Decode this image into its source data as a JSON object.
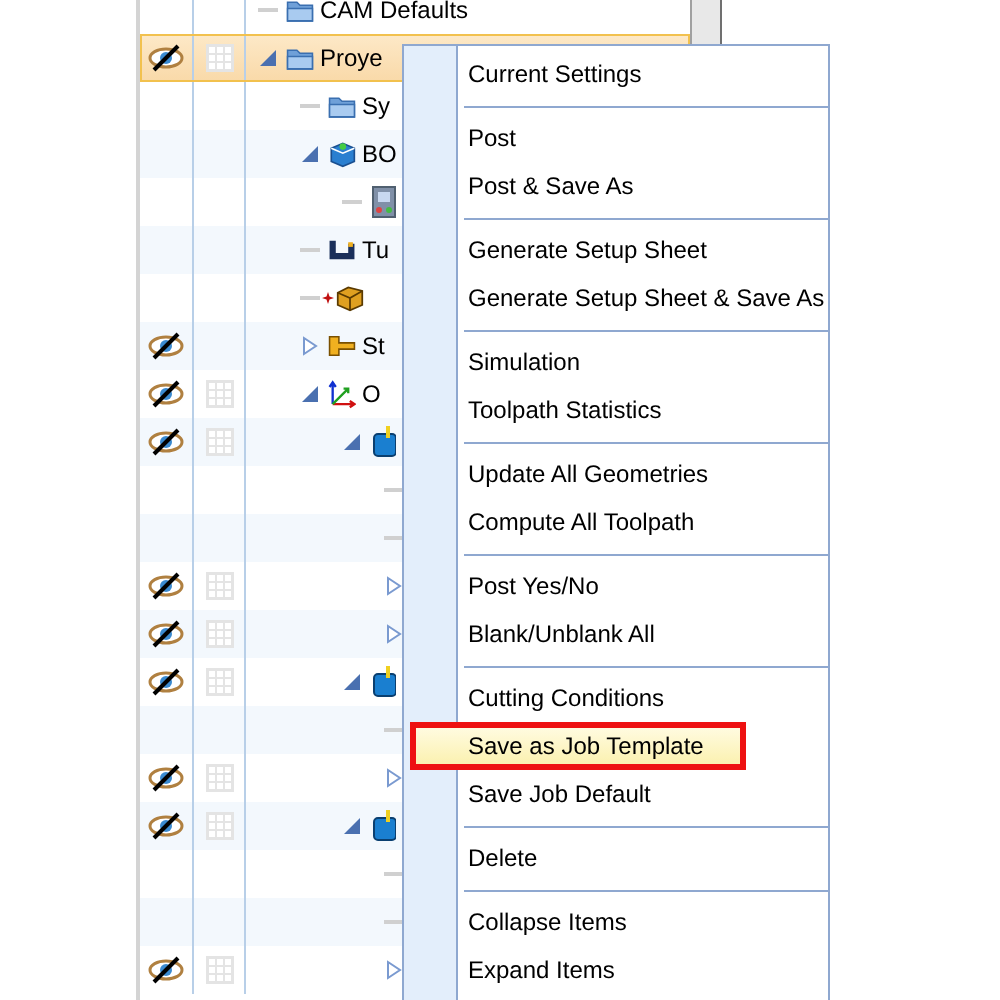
{
  "tree": [
    {
      "label": "CAM Defaults",
      "kind": "folder",
      "eye": false,
      "grid": false,
      "selected": false
    },
    {
      "label": "Proye",
      "kind": "folder",
      "eye": true,
      "grid": true,
      "selected": true,
      "expanded": true,
      "children": [
        {
          "label": "Sy",
          "kind": "folder",
          "eye": false,
          "grid": false,
          "selected": false
        },
        {
          "label": "BO",
          "kind": "machine",
          "eye": false,
          "grid": false,
          "selected": false,
          "expanded": true,
          "children": [
            {
              "kind": "panel",
              "eye": false,
              "grid": false,
              "selected": false
            }
          ]
        },
        {
          "label": "Tu",
          "kind": "tool",
          "eye": false,
          "grid": false,
          "selected": false
        },
        {
          "kind": "stock",
          "eye": false,
          "grid": false,
          "selected": false
        },
        {
          "label": "St",
          "kind": "fixture",
          "eye": true,
          "grid": false,
          "selected": false,
          "expanded": false
        },
        {
          "label": "O",
          "kind": "axes",
          "eye": true,
          "grid": true,
          "selected": false,
          "expanded": true,
          "children": [
            {
              "kind": "operation",
              "eye": true,
              "grid": true,
              "selected": false,
              "expanded": true,
              "children": [
                {
                  "eye": false,
                  "grid": false,
                  "selected": false
                },
                {
                  "eye": false,
                  "grid": false,
                  "selected": false
                },
                {
                  "eye": true,
                  "grid": true,
                  "selected": false,
                  "expanded": false
                },
                {
                  "eye": true,
                  "grid": true,
                  "selected": false,
                  "expanded": false
                }
              ]
            },
            {
              "kind": "operation",
              "eye": true,
              "grid": true,
              "selected": false,
              "expanded": true,
              "children": [
                {
                  "eye": false,
                  "grid": false,
                  "selected": false
                },
                {
                  "eye": true,
                  "grid": true,
                  "selected": false,
                  "expanded": false
                }
              ]
            },
            {
              "kind": "operation",
              "eye": true,
              "grid": true,
              "selected": false,
              "expanded": true,
              "children": [
                {
                  "eye": false,
                  "grid": false,
                  "selected": false
                },
                {
                  "eye": false,
                  "grid": false,
                  "selected": false
                },
                {
                  "eye": true,
                  "grid": true,
                  "selected": false,
                  "expanded": false
                }
              ]
            }
          ]
        }
      ]
    }
  ],
  "context_menu": {
    "groups": [
      [
        {
          "label": "Current Settings",
          "selected": false
        }
      ],
      [
        {
          "label": "Post",
          "selected": false
        },
        {
          "label": "Post & Save As",
          "selected": false
        }
      ],
      [
        {
          "label": "Generate Setup Sheet",
          "selected": false
        },
        {
          "label": "Generate Setup Sheet & Save As",
          "selected": false
        }
      ],
      [
        {
          "label": "Simulation",
          "selected": false
        },
        {
          "label": "Toolpath Statistics",
          "selected": false
        }
      ],
      [
        {
          "label": "Update All Geometries",
          "selected": false
        },
        {
          "label": "Compute All Toolpath",
          "selected": false
        }
      ],
      [
        {
          "label": "Post Yes/No",
          "selected": false
        },
        {
          "label": "Blank/Unblank All",
          "selected": false
        }
      ],
      [
        {
          "label": "Cutting Conditions",
          "selected": false
        },
        {
          "label": "Save as Job Template",
          "selected": true
        },
        {
          "label": "Save Job Default",
          "selected": false
        }
      ],
      [
        {
          "label": "Delete",
          "selected": false
        }
      ],
      [
        {
          "label": "Collapse Items",
          "selected": false
        },
        {
          "label": "Expand Items",
          "selected": false
        }
      ]
    ]
  }
}
